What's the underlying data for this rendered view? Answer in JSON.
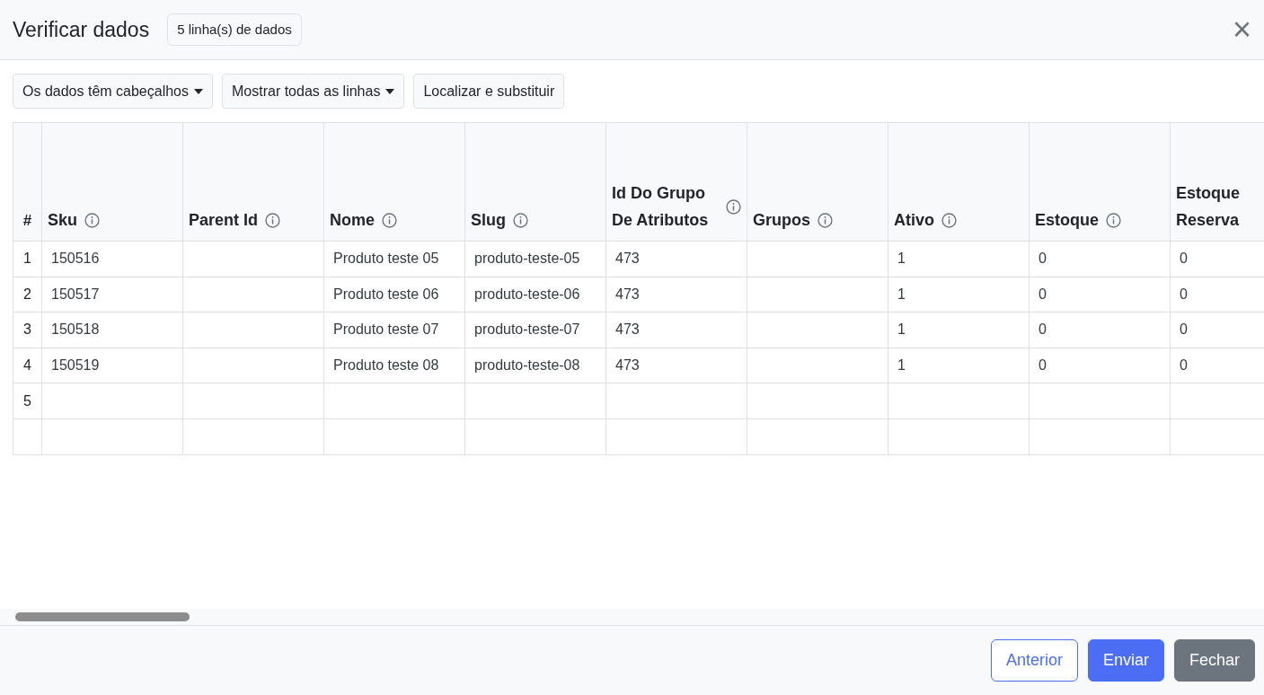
{
  "dialog": {
    "title": "Verificar dados",
    "badge": "5 linha(s) de dados",
    "close": "×"
  },
  "toolbar": [
    {
      "label": "Os dados têm cabeçalhos",
      "dropdown": true
    },
    {
      "label": "Mostrar todas as linhas",
      "dropdown": true
    },
    {
      "label": "Localizar e substituir",
      "dropdown": false
    }
  ],
  "table": {
    "index_header": "#",
    "columns": [
      {
        "label": "Sku",
        "info": true
      },
      {
        "label": "Parent Id",
        "info": true
      },
      {
        "label": "Nome",
        "info": true
      },
      {
        "label": "Slug",
        "info": true
      },
      {
        "label": "Id Do Grupo De Atributos",
        "info": true
      },
      {
        "label": "Grupos",
        "info": true
      },
      {
        "label": "Ativo",
        "info": true
      },
      {
        "label": "Estoque",
        "info": true
      },
      {
        "label": "Estoque Reserva",
        "info": false
      }
    ],
    "rows": [
      {
        "number": "1",
        "cells": [
          "150516",
          null,
          "Produto teste 05",
          "produto-teste-05",
          "473",
          null,
          "1",
          "0",
          "0"
        ]
      },
      {
        "number": "2",
        "cells": [
          "150517",
          null,
          "Produto teste 06",
          "produto-teste-06",
          "473",
          null,
          "1",
          "0",
          "0"
        ]
      },
      {
        "number": "3",
        "cells": [
          "150518",
          null,
          "Produto teste 07",
          "produto-teste-07",
          "473",
          null,
          "1",
          "0",
          "0"
        ]
      },
      {
        "number": "4",
        "cells": [
          "150519",
          null,
          "Produto teste 08",
          "produto-teste-08",
          "473",
          null,
          "1",
          "0",
          "0"
        ]
      },
      {
        "number": "5",
        "cells": [
          null,
          null,
          null,
          null,
          null,
          null,
          null,
          null,
          null
        ]
      },
      {
        "number": null,
        "cells": [
          null,
          null,
          null,
          null,
          null,
          null,
          null,
          null,
          null
        ]
      }
    ]
  },
  "footer": [
    {
      "label": "Anterior",
      "kind": "outline"
    },
    {
      "label": "Enviar",
      "kind": "primary"
    },
    {
      "label": "Fechar",
      "kind": "secondary"
    }
  ]
}
